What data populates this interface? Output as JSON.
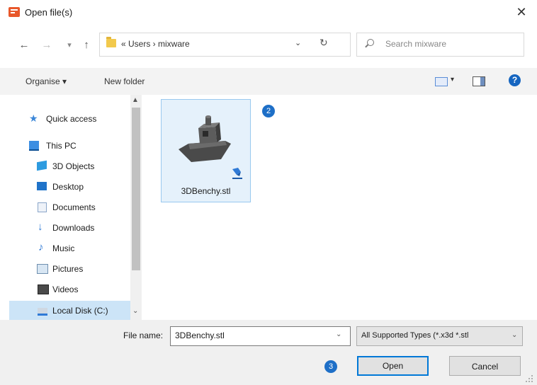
{
  "window": {
    "title": "Open file(s)",
    "close_glyph": "✕",
    "app_icon": "app-logo-icon"
  },
  "nav": {
    "back_glyph": "←",
    "forward_glyph": "→",
    "recent_glyph": "▾",
    "up_glyph": "↑"
  },
  "address": {
    "path": "« Users › mixware",
    "chevron": "⌄",
    "refresh": "↻"
  },
  "search": {
    "placeholder": "Search mixware"
  },
  "toolbar": {
    "organise": "Organise ▾",
    "new_folder": "New folder",
    "help": "?"
  },
  "sidebar": {
    "items": [
      {
        "label": "Quick access",
        "icon": "star-icon"
      },
      {
        "label": "This PC",
        "icon": "computer-icon"
      },
      {
        "label": "3D Objects",
        "icon": "3d-objects-icon"
      },
      {
        "label": "Desktop",
        "icon": "desktop-icon"
      },
      {
        "label": "Documents",
        "icon": "documents-icon"
      },
      {
        "label": "Downloads",
        "icon": "download-icon"
      },
      {
        "label": "Music",
        "icon": "music-icon"
      },
      {
        "label": "Pictures",
        "icon": "pictures-icon"
      },
      {
        "label": "Videos",
        "icon": "videos-icon"
      },
      {
        "label": "Local Disk (C:)",
        "icon": "disk-icon",
        "selected": true
      }
    ]
  },
  "files": [
    {
      "name": "3DBenchy.stl",
      "icon": "benchy-model-icon",
      "selected": true
    }
  ],
  "annotations": {
    "step2": "2",
    "step3": "3"
  },
  "footer": {
    "file_name_label": "File name:",
    "file_name_value": "3DBenchy.stl",
    "file_type": "All Supported Types (*.x3d *.stl",
    "open": "Open",
    "cancel": "Cancel"
  },
  "colors": {
    "selection": "#cce4f7",
    "accent": "#0078d7",
    "badge": "#1e6fc7"
  }
}
